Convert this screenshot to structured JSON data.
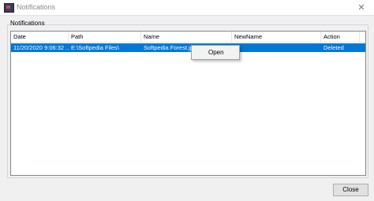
{
  "window": {
    "title": "Notifications",
    "app_icon": "app-icon",
    "close_glyph": "✕"
  },
  "group": {
    "label": "Notifications"
  },
  "table": {
    "columns": [
      "Date",
      "Path",
      "Name",
      "NewName",
      "Action"
    ],
    "rows": [
      {
        "date": "11/20/2020 9:06:32 ...",
        "path": "E:\\Softpedia Files\\",
        "name": "Softpedia Forest.jpg",
        "newname": "",
        "action": "Deleted",
        "selected": true
      }
    ]
  },
  "context_menu": {
    "items": [
      "Open"
    ]
  },
  "buttons": {
    "close": "Close"
  },
  "colors": {
    "selection": "#0078d7",
    "selection_text": "#ffffff",
    "window_bg": "#f0f0f0"
  }
}
